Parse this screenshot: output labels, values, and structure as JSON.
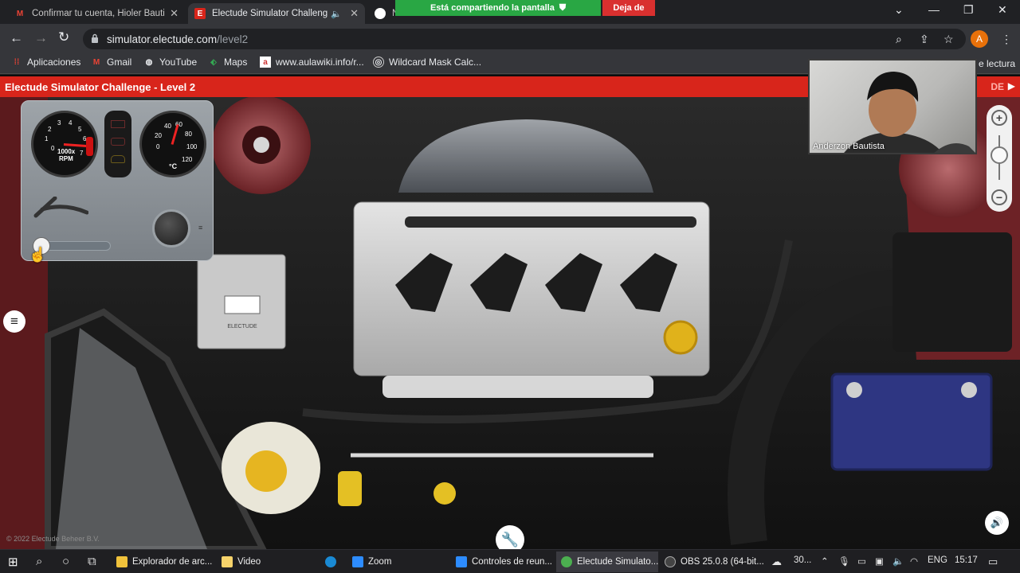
{
  "tabs": [
    {
      "title": "Confirmar tu cuenta, Hioler Bauti",
      "favicon": "gmail-icon",
      "active": false
    },
    {
      "title": "Electude Simulator Challeng",
      "favicon": "electude-icon",
      "active": true
    },
    {
      "title": "N",
      "favicon": "chrome-icon",
      "active": false
    }
  ],
  "screen_share": {
    "notice": "Está compartiendo la pantalla",
    "stop_label": "Deja de"
  },
  "address": {
    "host": "simulator.electude.com",
    "path": "/level2"
  },
  "profile_initial": "A",
  "bookmarks": [
    {
      "label": "Aplicaciones",
      "icon": "apps-grid-icon"
    },
    {
      "label": "Gmail",
      "icon": "gmail-icon"
    },
    {
      "label": "YouTube",
      "icon": "globe-icon"
    },
    {
      "label": "Maps",
      "icon": "maps-icon"
    },
    {
      "label": "www.aulawiki.info/r...",
      "icon": "aulawiki-icon"
    },
    {
      "label": "Wildcard Mask Calc...",
      "icon": "wildcard-icon"
    }
  ],
  "reading_list": "e lectura",
  "page": {
    "title": "Electude Simulator Challenge - Level 2",
    "brand_partial": "DE",
    "copyright": "© 2022 Electude Beheer B.V."
  },
  "dash": {
    "rpm_gauge": {
      "ticks": [
        "0",
        "1",
        "2",
        "3",
        "4",
        "5",
        "6",
        "7"
      ],
      "unit_line1": "1000x",
      "unit_line2": "RPM"
    },
    "temp_gauge": {
      "ticks": [
        "0",
        "20",
        "40",
        "60",
        "80",
        "100",
        "120"
      ],
      "unit": "°C"
    }
  },
  "webcam": {
    "participant": "Anderzon Bautista"
  },
  "taskbar": {
    "apps": [
      {
        "label": "Explorador de arc...",
        "color": "#f0c23b"
      },
      {
        "label": "Video",
        "color": "#f6d36b"
      },
      {
        "label": "",
        "color": "#1a8ad4"
      },
      {
        "label": "Zoom",
        "color": "#2d8cff"
      },
      {
        "label": "Controles de reun...",
        "color": "#2d8cff"
      },
      {
        "label": "Electude Simulato...",
        "color": "#4caf50"
      },
      {
        "label": "OBS 25.0.8 (64-bit...",
        "color": "#444444"
      }
    ],
    "weather": "30...",
    "language": "ENG",
    "time": "15:17"
  }
}
